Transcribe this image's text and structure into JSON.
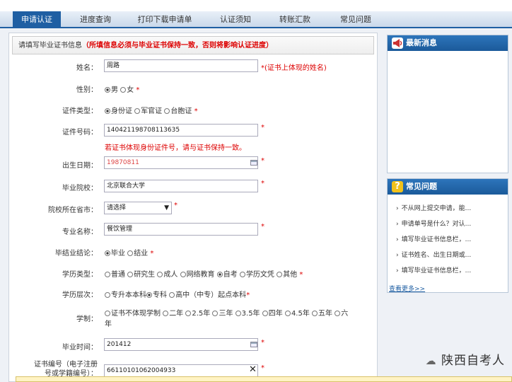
{
  "nav": {
    "tabs": [
      "申请认证",
      "进度查询",
      "打印下载申请单",
      "认证须知",
      "转账汇款",
      "常见问题"
    ],
    "active_index": 0
  },
  "form": {
    "header": "请填写毕业证书信息",
    "warning": "（所填信息必须与毕业证书保持一致，否则将影响认证进度）",
    "name_label": "姓名：",
    "name_value": "周路",
    "name_note": "*(证书上体现的姓名)",
    "gender_label": "性别：",
    "gender_options": [
      "男",
      "女"
    ],
    "gender_selected": "男",
    "id_type_label": "证件类型：",
    "id_type_options": [
      "身份证",
      "军官证",
      "台胞证"
    ],
    "id_type_selected": "身份证",
    "id_no_label": "证件号码：",
    "id_no_value": "140421198708113635",
    "id_no_note": "若证书体现身份证件号，请与证书保持一致。",
    "birth_label": "出生日期：",
    "birth_value": "19870811",
    "school_label": "毕业院校：",
    "school_value": "北京联合大学",
    "province_label": "院校所在省市：",
    "province_value": "请选择",
    "major_label": "专业名称：",
    "major_value": "餐饮管理",
    "conclusion_label": "毕结业结论：",
    "conclusion_options": [
      "毕业",
      "结业"
    ],
    "conclusion_selected": "毕业",
    "edu_type_label": "学历类型：",
    "edu_type_options": [
      "普通",
      "研究生",
      "成人",
      "网络教育",
      "自考",
      "学历文凭",
      "其他"
    ],
    "edu_type_selected": "自考",
    "edu_level_label": "学历层次：",
    "edu_level_options": [
      "专升本本科",
      "专科",
      "高中（中专）起点本科"
    ],
    "edu_level_selected": "专科",
    "length_label": "学制：",
    "length_options": [
      "证书不体现学制",
      "二年",
      "2.5年",
      "三年",
      "3.5年",
      "四年",
      "4.5年",
      "五年",
      "六年"
    ],
    "length_selected": "",
    "grad_time_label": "毕业时间：",
    "grad_time_value": "201412",
    "cert_no_label_1": "证书编号（电子注册",
    "cert_no_label_2": "号或学籍编号）：",
    "cert_no_value": "661101010620049​33",
    "required_mark": "*"
  },
  "news": {
    "title": "最新消息"
  },
  "faq": {
    "title": "常见问题",
    "items": [
      "不从网上提交申请，能...",
      "申请单号是什么？对认...",
      "填写毕业证书信息栏，...",
      "证书姓名、出生日期或...",
      "填写毕业证书信息栏，..."
    ],
    "more": "查看更多>>"
  },
  "watermark": "陕西自考人",
  "colors": {
    "brand": "#1f5fa3",
    "required": "#dd0000"
  }
}
